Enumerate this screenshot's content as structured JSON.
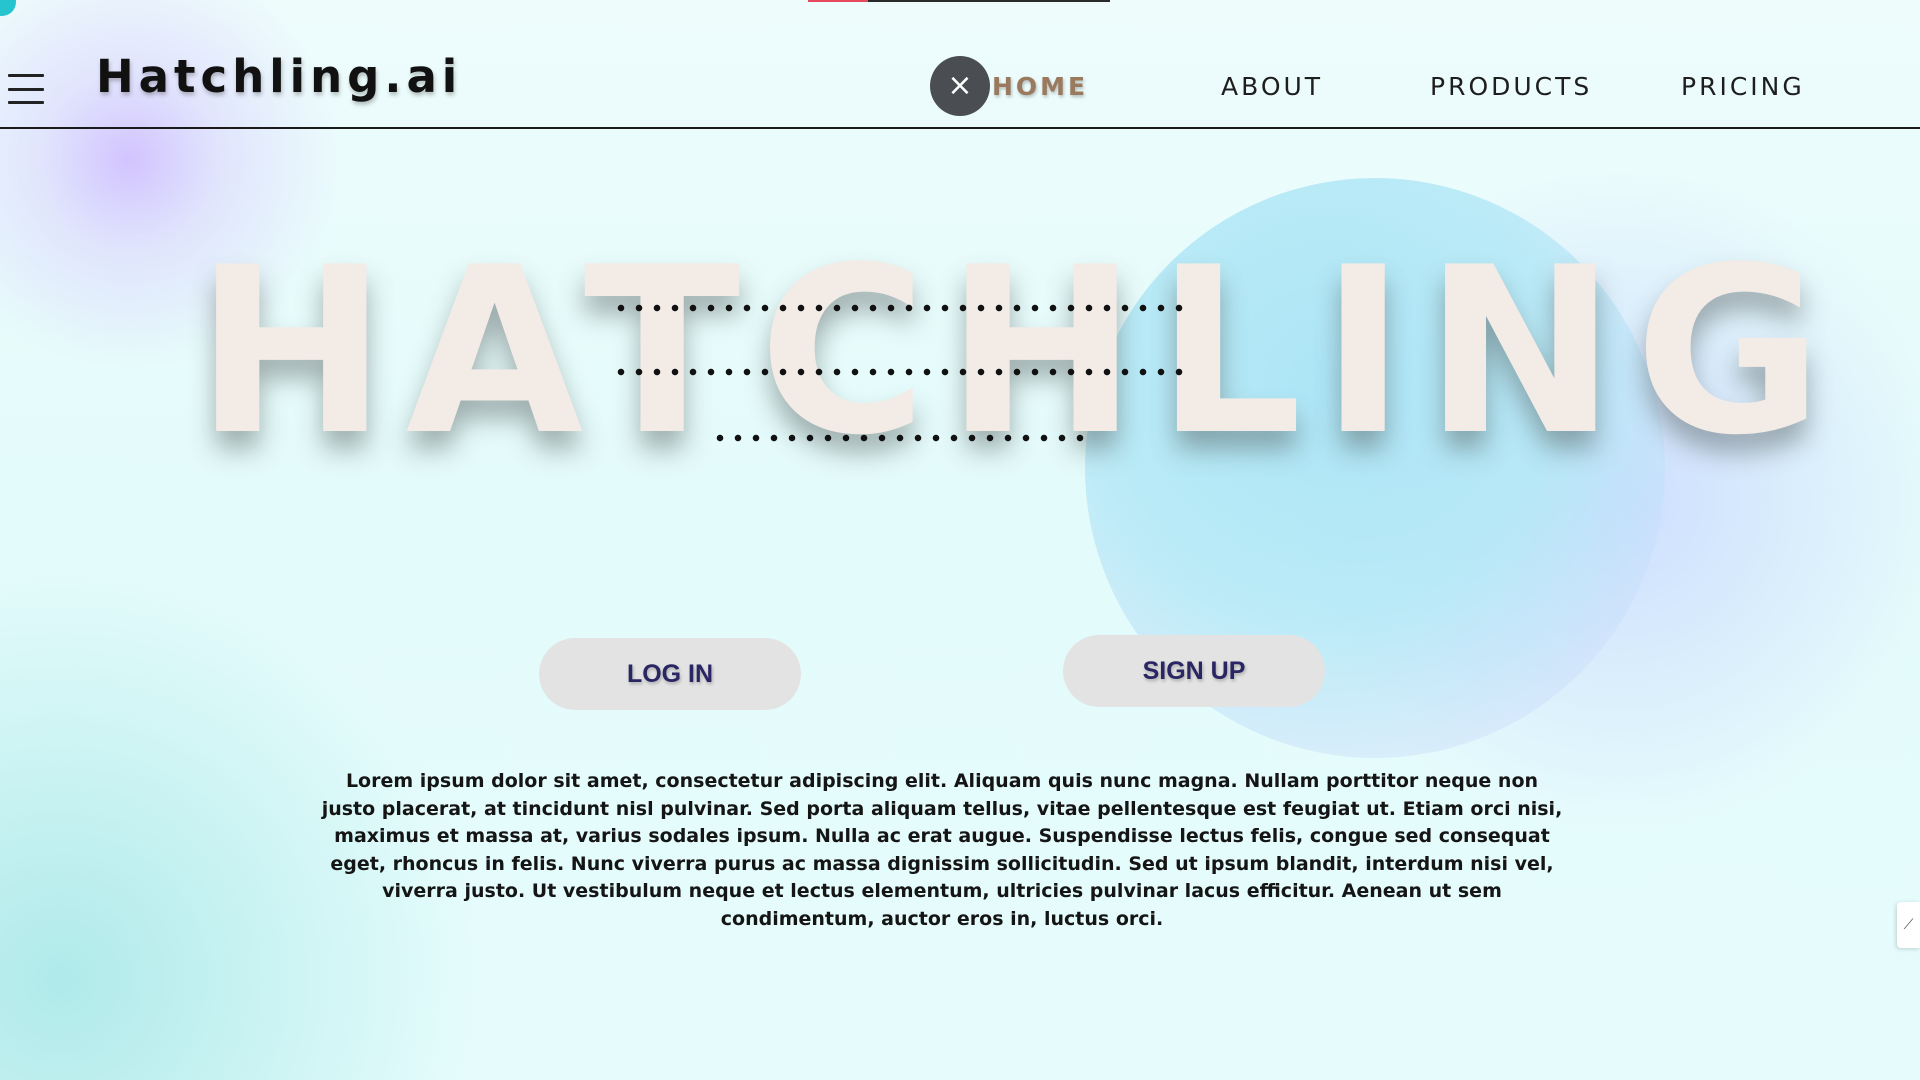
{
  "header": {
    "brand": "Hatchling.ai",
    "close_glyph": "×",
    "nav": [
      {
        "label": "HOME",
        "active": true
      },
      {
        "label": "ABOUT"
      },
      {
        "label": "PRODUCTS"
      },
      {
        "label": "PRICING"
      }
    ]
  },
  "hero": {
    "title": "HATCHLING"
  },
  "actions": {
    "login_label": "LOG IN",
    "signup_label": "SIGN UP"
  },
  "body": {
    "text": "Lorem ipsum dolor sit amet, consectetur adipiscing elit. Aliquam quis nunc magna. Nullam porttitor neque non justo placerat, at tincidunt nisl pulvinar. Sed porta aliquam tellus, vitae pellentesque est feugiat ut. Etiam orci nisi, maximus et massa at, varius sodales ipsum. Nulla ac erat augue. Suspendisse lectus felis, congue sed consequat eget, rhoncus in felis. Nunc viverra purus ac massa dignissim sollicitudin. Sed ut ipsum blandit, interdum nisi vel, viverra justo. Ut vestibulum neque et lectus elementum, ultricies pulvinar lacus efficitur. Aenean ut sem condimentum, auctor eros in, luctus orci."
  },
  "scroll_progress": 0.2,
  "side_tab_glyph": "⟋",
  "icons": {
    "menu": "hamburger-menu-icon",
    "close": "close-icon"
  },
  "colors": {
    "active_nav": "#9a7a5e",
    "button_text": "#2a2663",
    "button_bg": "#e3e3e3",
    "progress_fill": "#e74a5d",
    "hero_text": "#f3ebe5"
  }
}
